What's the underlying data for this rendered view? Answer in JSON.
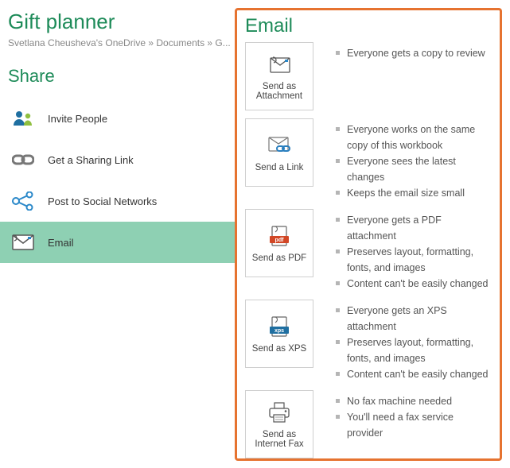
{
  "page_title": "Gift planner",
  "breadcrumb": "Svetlana Cheusheva's OneDrive » Documents » G...",
  "share_heading": "Share",
  "share_items": [
    {
      "label": "Invite People",
      "icon": "invite-people-icon",
      "selected": false
    },
    {
      "label": "Get a Sharing Link",
      "icon": "sharing-link-icon",
      "selected": false
    },
    {
      "label": "Post to Social Networks",
      "icon": "social-networks-icon",
      "selected": false
    },
    {
      "label": "Email",
      "icon": "email-icon",
      "selected": true
    }
  ],
  "email_panel_heading": "Email",
  "email_options": [
    {
      "label": "Send as Attachment",
      "icon": "attachment-icon",
      "points": [
        "Everyone gets a copy to review"
      ]
    },
    {
      "label": "Send a Link",
      "icon": "send-link-icon",
      "points": [
        "Everyone works on the same copy of this workbook",
        "Everyone sees the latest changes",
        "Keeps the email size small"
      ]
    },
    {
      "label": "Send as PDF",
      "icon": "pdf-icon",
      "points": [
        "Everyone gets a PDF attachment",
        "Preserves layout, formatting, fonts, and images",
        "Content can't be easily changed"
      ]
    },
    {
      "label": "Send as XPS",
      "icon": "xps-icon",
      "points": [
        "Everyone gets an XPS attachment",
        "Preserves layout, formatting, fonts, and images",
        "Content can't be easily changed"
      ]
    },
    {
      "label": "Send as Internet Fax",
      "icon": "fax-icon",
      "points": [
        "No fax machine needed",
        "You'll need a fax service provider"
      ]
    }
  ]
}
